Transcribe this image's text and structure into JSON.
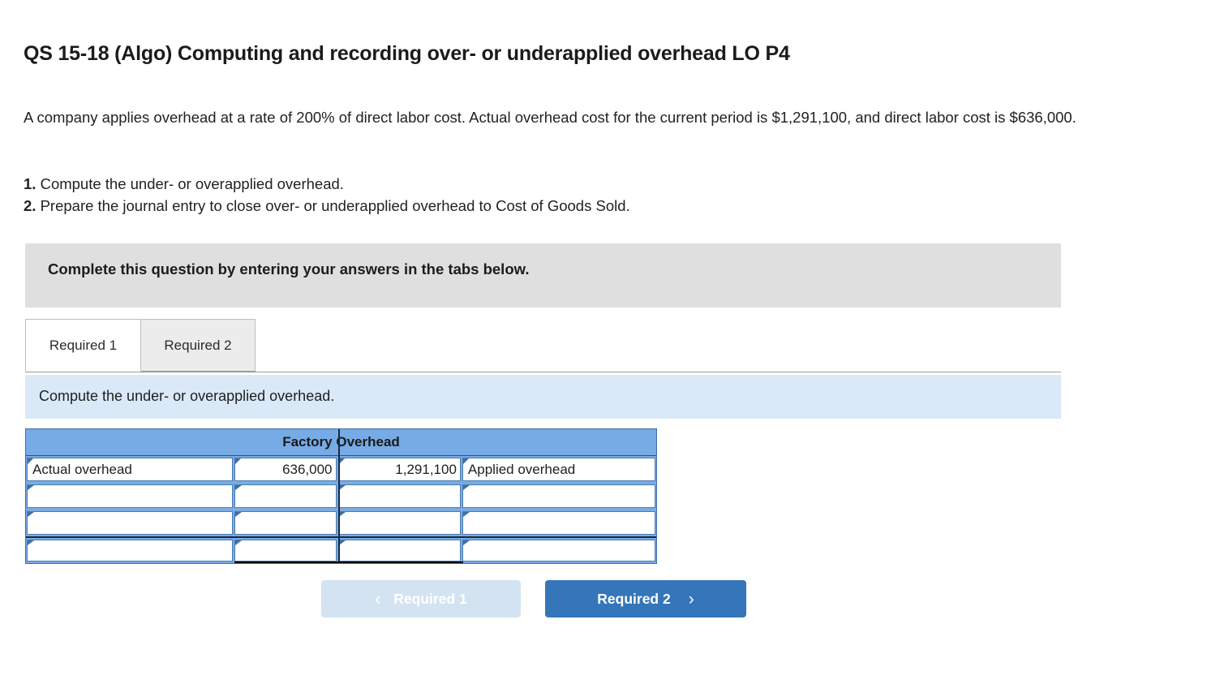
{
  "question": {
    "title": "QS 15-18 (Algo) Computing and recording over- or underapplied overhead LO P4",
    "body_line1": "A company applies overhead at a rate of 200% of direct labor cost. Actual overhead cost for the current period is $1,291,100, and direct",
    "body_line2": "labor cost is $636,000.",
    "item1_num": "1.",
    "item1_text": " Compute the under- or overapplied overhead.",
    "item2_num": "2.",
    "item2_text": " Prepare the journal entry to close over- or underapplied overhead to Cost of Goods Sold."
  },
  "instruction_banner": {
    "text": "Complete this question by entering your answers in the tabs below."
  },
  "tabs": [
    {
      "label": "Required 1",
      "active": true
    },
    {
      "label": "Required 2",
      "active": false
    }
  ],
  "requirement_bar": {
    "text": "Compute the under- or overapplied overhead."
  },
  "taccount": {
    "header": "Factory Overhead",
    "rows": [
      {
        "debit_label": "Actual overhead",
        "debit_amount": "636,000",
        "credit_amount": "1,291,100",
        "credit_label": "Applied overhead"
      },
      {
        "debit_label": "",
        "debit_amount": "",
        "credit_amount": "",
        "credit_label": ""
      },
      {
        "debit_label": "",
        "debit_amount": "",
        "credit_amount": "",
        "credit_label": ""
      },
      {
        "debit_label": "",
        "debit_amount": "",
        "credit_amount": "",
        "credit_label": ""
      }
    ]
  },
  "navigation": {
    "prev_chevron": "‹",
    "prev_label": "Required 1",
    "next_label": "Required 2",
    "next_chevron": "›"
  },
  "colors": {
    "table_header_blue": "#77abe6",
    "table_border_blue": "#4a7cb5",
    "instruction_gray": "#dfdfdf",
    "requirement_blue": "#d9e9f8",
    "button_blue": "#3575b9",
    "button_disabled_blue": "#d3e3f2"
  }
}
